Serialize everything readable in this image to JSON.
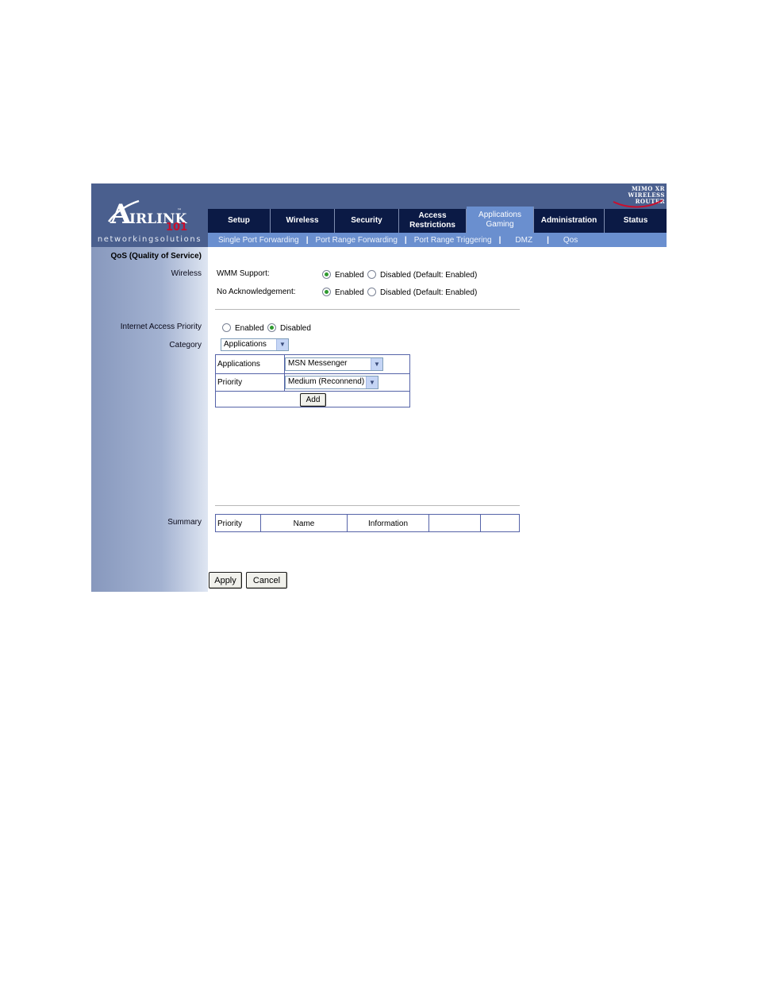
{
  "logo": {
    "brand_a": "A",
    "brand_irlink": "IRLINK",
    "brand_num": "101",
    "tm": "™",
    "tagline": "networkingsolutions"
  },
  "badge": {
    "line1": "MIMO XR",
    "line2": "WIRELESS ROUTER"
  },
  "tabs": [
    {
      "label_line1": "Setup",
      "label_line2": ""
    },
    {
      "label_line1": "Wireless",
      "label_line2": ""
    },
    {
      "label_line1": "Security",
      "label_line2": ""
    },
    {
      "label_line1": "Access",
      "label_line2": "Restrictions"
    },
    {
      "label_line1": "Applications",
      "label_line2": "Gaming"
    },
    {
      "label_line1": "Administration",
      "label_line2": ""
    },
    {
      "label_line1": "Status",
      "label_line2": ""
    }
  ],
  "subnav": [
    "Single Port Forwarding",
    "Port Range Forwarding",
    "Port Range Triggering",
    "DMZ",
    "Qos"
  ],
  "separator": "|",
  "sidebar": {
    "section_title": "QoS (Quality of Service)",
    "wireless_label": "Wireless",
    "iap_label": "Internet Access Priority",
    "category_label": "Category",
    "summary_label": "Summary"
  },
  "wireless": {
    "wmm_label": "WMM Support:",
    "noack_label": "No Acknowledgement:",
    "enabled": "Enabled",
    "disabled_default": "Disabled (Default: Enabled)"
  },
  "iap": {
    "enabled": "Enabled",
    "disabled": "Disabled"
  },
  "category": {
    "selected": "Applications"
  },
  "app_table": {
    "applications_label": "Applications",
    "applications_value": "MSN Messenger",
    "priority_label": "Priority",
    "priority_value": "Medium (Reconnend)",
    "add_label": "Add"
  },
  "summary_table": {
    "headers": [
      "Priority",
      "Name",
      "Information",
      "",
      ""
    ]
  },
  "buttons": {
    "apply": "Apply",
    "cancel": "Cancel"
  },
  "colors": {
    "header_blue": "#4a5f8e",
    "tab_navy": "#0b1a45",
    "tab_active": "#6a8fcf",
    "radio_green": "#2f9a2f",
    "logo_red": "#c8102e"
  }
}
